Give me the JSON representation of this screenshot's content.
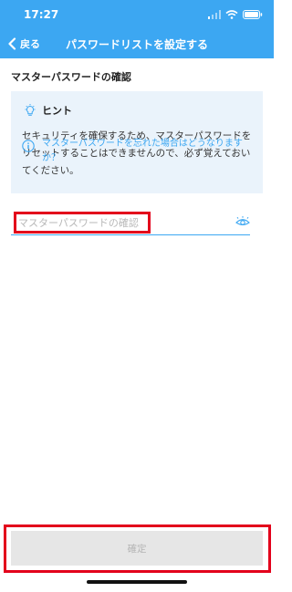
{
  "status_bar": {
    "time": "17:27",
    "icons": [
      "cellular-icon",
      "wifi-icon",
      "battery-icon"
    ]
  },
  "nav": {
    "back_label": "戻る",
    "title": "パスワードリストを設定する"
  },
  "section_title": "マスターパスワードの確認",
  "hint": {
    "title": "ヒント",
    "body": "セキュリティを確保するため、マスターパスワードをリセットすることはできませんので、必ず覚えておいてください。",
    "help_link": "マスターパスワードを忘れた場合はどうなりますか？"
  },
  "password_field": {
    "placeholder": "マスターパスワードの確認",
    "value": ""
  },
  "footer": {
    "confirm_label": "確定"
  },
  "colors": {
    "accent": "#3ca7f2",
    "highlight": "#e3001b",
    "hint_bg": "#eaf3fb",
    "disabled_button": "#e6e6e6"
  }
}
